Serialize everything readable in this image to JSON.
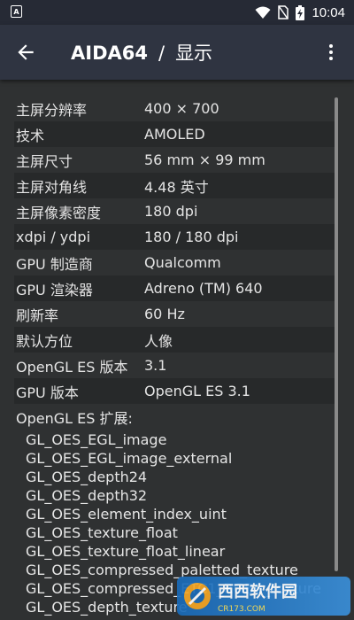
{
  "status_bar": {
    "time": "10:04",
    "notification_letter": "A"
  },
  "app_bar": {
    "app_name": "AIDA64",
    "separator": "/",
    "section": "显示"
  },
  "rows": [
    {
      "label": "主屏分辨率",
      "value": "400 × 700"
    },
    {
      "label": "技术",
      "value": "AMOLED"
    },
    {
      "label": "主屏尺寸",
      "value": "56 mm × 99 mm"
    },
    {
      "label": "主屏对角线",
      "value": "4.48 英寸"
    },
    {
      "label": "主屏像素密度",
      "value": "180 dpi"
    },
    {
      "label": "xdpi / ydpi",
      "value": "180 / 180 dpi"
    },
    {
      "label": "GPU 制造商",
      "value": "Qualcomm"
    },
    {
      "label": "GPU 渲染器",
      "value": "Adreno (TM) 640"
    },
    {
      "label": "刷新率",
      "value": "60 Hz"
    },
    {
      "label": "默认方位",
      "value": "人像"
    },
    {
      "label": "OpenGL ES 版本",
      "value": "3.1"
    },
    {
      "label": "GPU 版本",
      "value": "OpenGL ES 3.1"
    }
  ],
  "extensions": {
    "header": "OpenGL ES 扩展:",
    "items": [
      "GL_OES_EGL_image",
      "GL_OES_EGL_image_external",
      "GL_OES_depth24",
      "GL_OES_depth32",
      "GL_OES_element_index_uint",
      "GL_OES_texture_float",
      "GL_OES_texture_float_linear",
      "GL_OES_compressed_paletted_texture",
      "GL_OES_compressed_ETC1_RGB8_texture",
      "GL_OES_depth_texture"
    ]
  },
  "watermark": {
    "name": "西西软件园",
    "domain": "CR173.COM"
  },
  "colors": {
    "app_bar": "#2f3441",
    "background": "#2f3132",
    "alt_row": "#27292a"
  }
}
